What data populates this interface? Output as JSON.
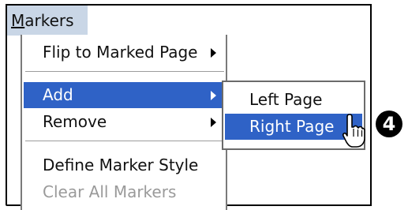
{
  "menubar": {
    "menu_mnemonic": "M",
    "menu_rest": "arkers",
    "menu_color": "#c9d6e6"
  },
  "menu": {
    "items": [
      {
        "label": "Flip to Marked Page"
      },
      {
        "label": "Add"
      },
      {
        "label": "Remove"
      },
      {
        "label": "Define Marker Style"
      },
      {
        "label": "Clear All Markers"
      }
    ]
  },
  "submenu": {
    "items": [
      {
        "label": "Left Page"
      },
      {
        "label": "Right Page"
      }
    ]
  },
  "callout": {
    "text": "4"
  },
  "colors": {
    "highlight": "#2f62c6",
    "disabled_text": "#9a9a9a"
  }
}
